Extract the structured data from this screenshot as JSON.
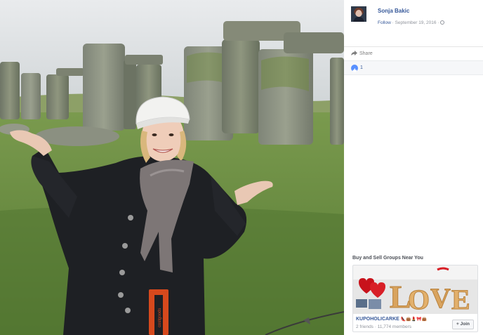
{
  "post": {
    "author_name": "Sonja Bakic",
    "follow_label": "Follow",
    "separator": "·",
    "date": "September 19, 2016",
    "privacy_icon": "globe-icon"
  },
  "actions": {
    "share_label": "Share",
    "share_icon": "share-arrow-icon"
  },
  "reactions": {
    "icon": "like-thumb-icon",
    "count": "1",
    "color": "#5890ff"
  },
  "groups": {
    "section_title": "Buy and Sell Groups Near You",
    "items": [
      {
        "name": "KUPOHOLICARKE",
        "emoji": "👠👜💄🎀👜",
        "members": "2 friends · 11,774 members",
        "join_label": "+ Join"
      }
    ]
  },
  "photo": {
    "description_icon": "stonehenge-photo",
    "bag_text": "costgoods"
  },
  "colors": {
    "link": "#365899",
    "muted": "#90949c",
    "like": "#5890ff"
  }
}
